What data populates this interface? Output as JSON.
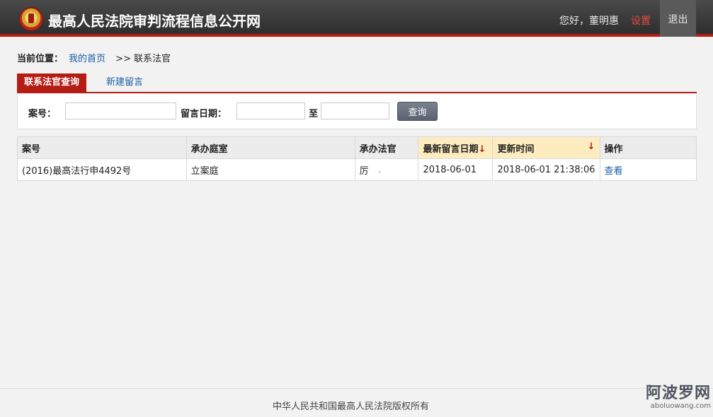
{
  "header": {
    "site_title": "最高人民法院审判流程信息公开网",
    "greeting": "您好，董明惠",
    "settings": "设置",
    "logout": "退出"
  },
  "breadcrumb": {
    "label": "当前位置：",
    "home": "我的首页",
    "separator": ">>",
    "current": "联系法官"
  },
  "tabs": [
    {
      "label": "联系法官查询",
      "active": true
    },
    {
      "label": "新建留言",
      "active": false
    }
  ],
  "search": {
    "case_no_label": "案号：",
    "date_label": "留言日期：",
    "to_label": "至",
    "button": "查询",
    "case_no_value": "",
    "date_from_value": "",
    "date_to_value": ""
  },
  "table": {
    "columns": [
      "案号",
      "承办庭室",
      "承办法官",
      "最新留言日期",
      "更新时间",
      "操作"
    ],
    "sort_arrow": "↓",
    "rows": [
      {
        "case_no": "(2016)最高法行申4492号",
        "department": "立案庭",
        "judge": "厉",
        "latest_date": "2018-06-01",
        "updated": "2018-06-01 21:38:06",
        "action": "查看"
      }
    ]
  },
  "footer": {
    "copyright": "中华人民共和国最高人民法院版权所有"
  },
  "watermark": {
    "main": "阿波罗网",
    "sub": "aboluowang.com"
  },
  "colors": {
    "brand_red": "#b51d14",
    "link_blue": "#1a5fa8",
    "header_dark": "#2e2e2e",
    "sorted_header": "#fcecbf"
  }
}
